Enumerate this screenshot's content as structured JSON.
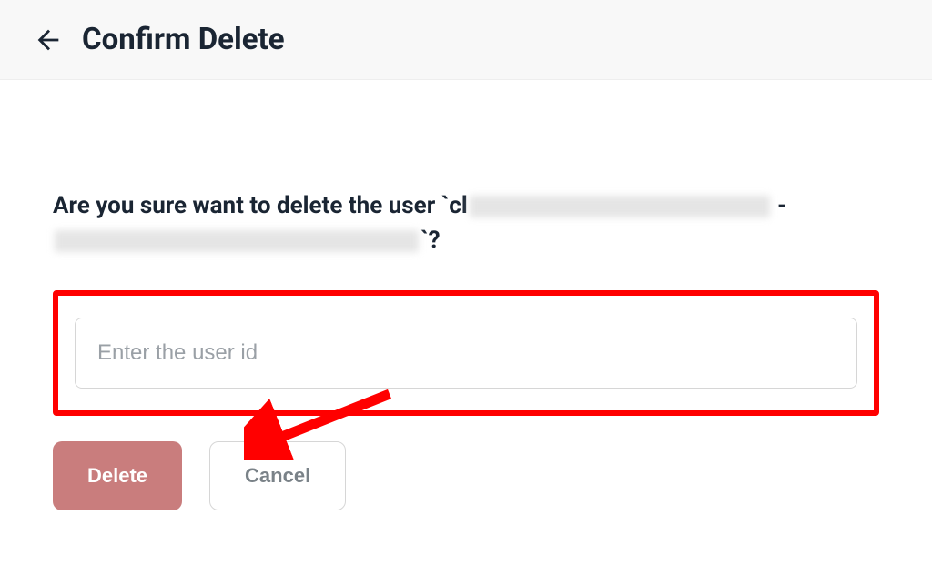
{
  "header": {
    "title": "Confirm Delete"
  },
  "prompt": {
    "prefix": "Are you sure want to delete the user `cl",
    "dash": " - ",
    "suffix": "`?"
  },
  "input": {
    "placeholder": "Enter the user id",
    "value": ""
  },
  "buttons": {
    "delete_label": "Delete",
    "cancel_label": "Cancel"
  }
}
